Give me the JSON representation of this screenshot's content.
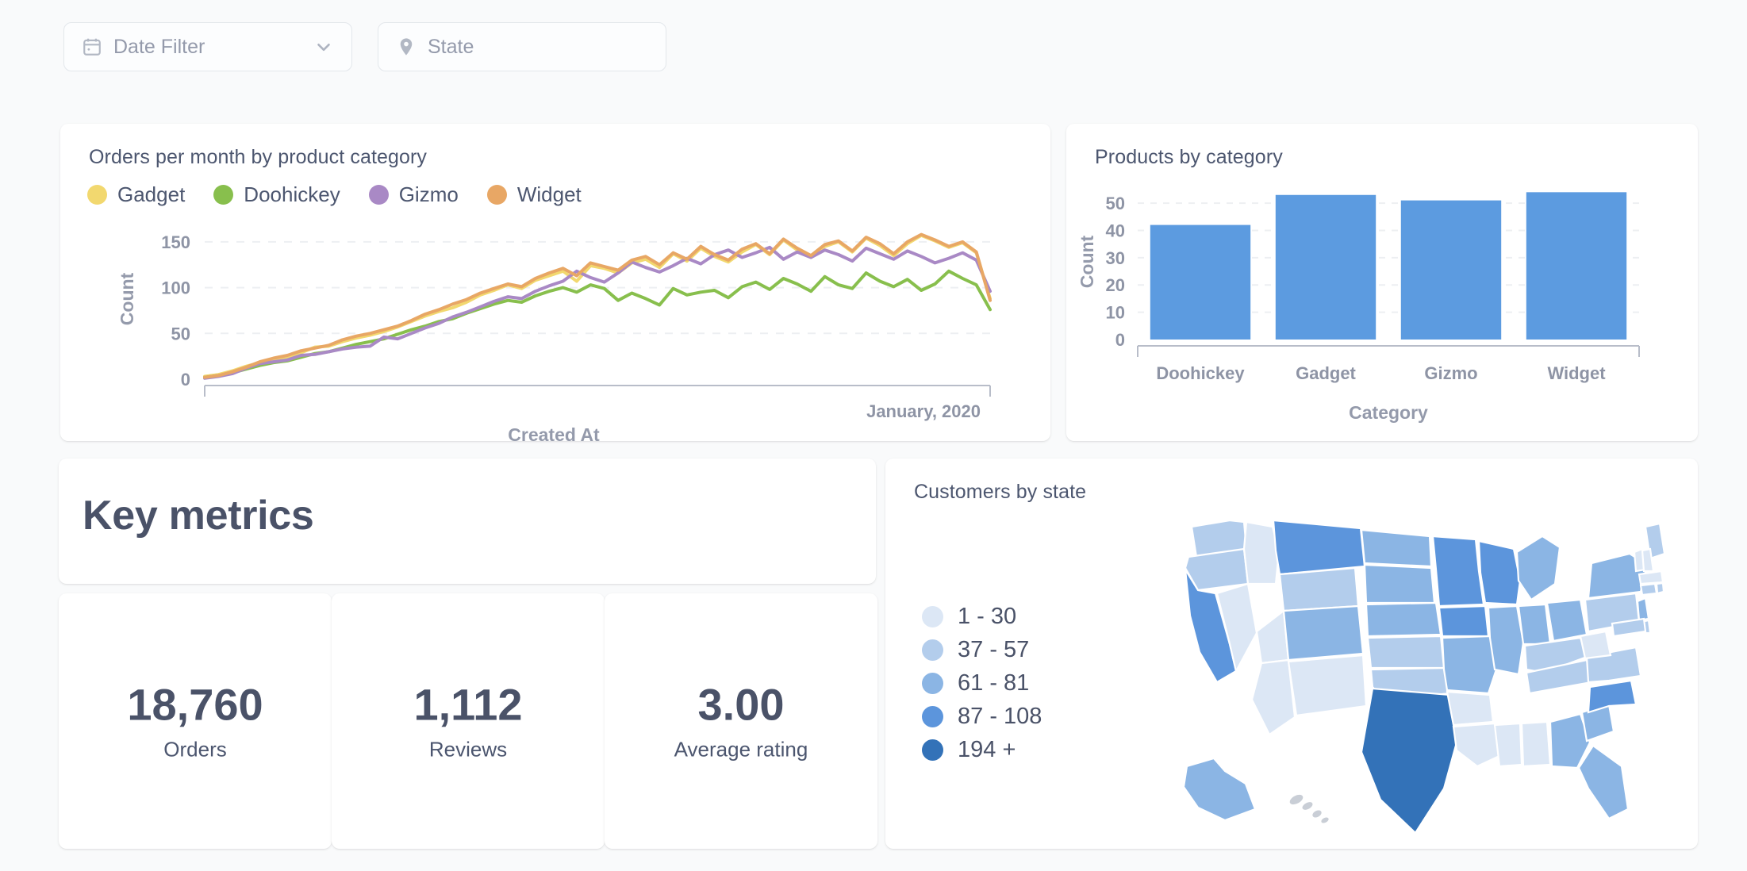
{
  "filters": [
    {
      "name": "date-filter",
      "label": "Date Filter",
      "icon": "calendar-icon",
      "has_chevron": true
    },
    {
      "name": "state-filter",
      "label": "State",
      "icon": "map-pin-icon",
      "has_chevron": false
    }
  ],
  "cards": {
    "line": {
      "title": "Orders per month by product category"
    },
    "bar": {
      "title": "Products by category"
    },
    "key_metrics": {
      "heading": "Key metrics"
    },
    "map": {
      "title": "Customers by state"
    }
  },
  "scalars": [
    {
      "value": "18,760",
      "label": "Orders"
    },
    {
      "value": "1,112",
      "label": "Reviews"
    },
    {
      "value": "3.00",
      "label": "Average rating"
    }
  ],
  "map_legend": [
    {
      "label": "1 - 30",
      "color": "#DCE7F5"
    },
    {
      "label": "37 - 57",
      "color": "#B3CDEC"
    },
    {
      "label": "61 - 81",
      "color": "#8BB5E4"
    },
    {
      "label": "87 - 108",
      "color": "#5C95DC"
    },
    {
      "label": "194 +",
      "color": "#3372B8"
    }
  ],
  "colors": {
    "gadget": "#F2D86F",
    "doohickey": "#88BF4D",
    "gizmo": "#A989C5",
    "widget": "#E8A765",
    "bar_blue": "#5C9BE0",
    "text_dark": "#4A5268",
    "text_muted": "#949AAB",
    "background": "#F9FAFB"
  },
  "chart_data": [
    {
      "id": "orders-per-month-line",
      "type": "line",
      "title": "Orders per month by product category",
      "xlabel": "Created At",
      "ylabel": "Count",
      "ylim": [
        0,
        175
      ],
      "yticks": [
        0,
        50,
        100,
        150
      ],
      "grid": true,
      "legend": [
        "Gadget",
        "Doohickey",
        "Gizmo",
        "Widget"
      ],
      "legend_position": "top-left",
      "x_axis_end_label": "January, 2020",
      "x_count": 58,
      "series": [
        {
          "name": "Gadget",
          "color": "#F2D86F",
          "values": [
            3,
            5,
            9,
            14,
            18,
            22,
            23,
            29,
            35,
            36,
            41,
            45,
            48,
            52,
            57,
            63,
            69,
            74,
            78,
            84,
            92,
            97,
            103,
            99,
            108,
            113,
            118,
            107,
            124,
            121,
            116,
            127,
            131,
            122,
            137,
            129,
            143,
            134,
            128,
            139,
            147,
            136,
            152,
            141,
            133,
            145,
            150,
            139,
            154,
            146,
            135,
            148,
            157,
            151,
            144,
            149,
            138,
            88
          ]
        },
        {
          "name": "Doohickey",
          "color": "#88BF4D",
          "values": [
            2,
            4,
            7,
            11,
            15,
            18,
            20,
            24,
            28,
            30,
            34,
            38,
            41,
            44,
            49,
            54,
            58,
            63,
            66,
            72,
            77,
            82,
            86,
            84,
            91,
            96,
            100,
            95,
            103,
            99,
            86,
            94,
            88,
            81,
            99,
            92,
            95,
            97,
            89,
            101,
            106,
            98,
            110,
            104,
            96,
            112,
            103,
            99,
            116,
            107,
            101,
            109,
            97,
            104,
            118,
            110,
            103,
            76
          ]
        },
        {
          "name": "Gizmo",
          "color": "#A989C5",
          "values": [
            1,
            3,
            6,
            12,
            17,
            19,
            21,
            26,
            27,
            30,
            33,
            35,
            36,
            46,
            44,
            50,
            56,
            61,
            68,
            73,
            79,
            85,
            90,
            88,
            96,
            102,
            107,
            118,
            111,
            106,
            116,
            128,
            122,
            117,
            124,
            132,
            126,
            136,
            141,
            133,
            138,
            144,
            131,
            139,
            133,
            141,
            136,
            129,
            143,
            137,
            131,
            140,
            134,
            127,
            132,
            138,
            130,
            96
          ]
        },
        {
          "name": "Widget",
          "color": "#E8A765",
          "values": [
            2,
            4,
            8,
            13,
            19,
            23,
            26,
            31,
            34,
            37,
            43,
            47,
            50,
            54,
            58,
            64,
            71,
            76,
            82,
            87,
            94,
            99,
            104,
            101,
            110,
            116,
            121,
            113,
            127,
            123,
            119,
            130,
            134,
            125,
            138,
            131,
            145,
            136,
            130,
            142,
            148,
            137,
            153,
            143,
            135,
            147,
            151,
            140,
            155,
            148,
            137,
            150,
            158,
            152,
            145,
            150,
            139,
            86
          ]
        }
      ]
    },
    {
      "id": "products-by-category-bar",
      "type": "bar",
      "title": "Products by category",
      "xlabel": "Category",
      "ylabel": "Count",
      "ylim": [
        0,
        57
      ],
      "yticks": [
        0,
        10,
        20,
        30,
        40,
        50
      ],
      "grid": true,
      "categories": [
        "Doohickey",
        "Gadget",
        "Gizmo",
        "Widget"
      ],
      "values": [
        42,
        53,
        51,
        54
      ],
      "color": "#5C9BE0"
    },
    {
      "id": "customers-by-state-map",
      "type": "choropleth",
      "title": "Customers by state",
      "region": "United States",
      "legend_position": "left",
      "bins": [
        {
          "label": "1 - 30",
          "color": "#DCE7F5"
        },
        {
          "label": "37 - 57",
          "color": "#B3CDEC"
        },
        {
          "label": "61 - 81",
          "color": "#8BB5E4"
        },
        {
          "label": "87 - 108",
          "color": "#5C95DC"
        },
        {
          "label": "194 +",
          "color": "#3372B8"
        }
      ],
      "highlight_state": "Texas"
    }
  ]
}
